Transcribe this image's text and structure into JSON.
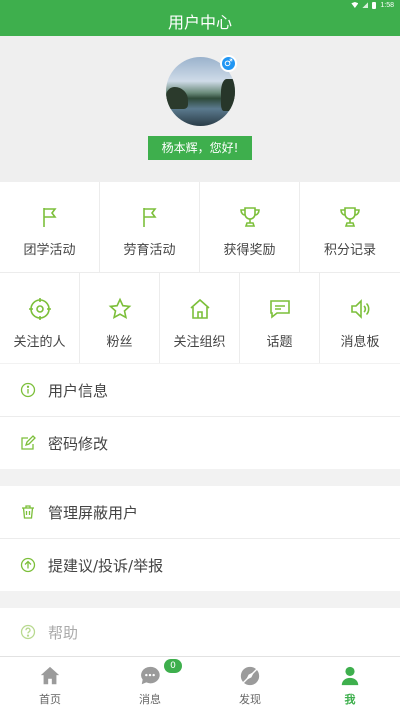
{
  "status_bar": {
    "time": "1:58"
  },
  "header": {
    "title": "用户中心"
  },
  "profile": {
    "greeting": "杨本辉，您好!",
    "gender_symbol": "♂"
  },
  "row1": [
    {
      "label": "团学活动",
      "icon": "flag-icon"
    },
    {
      "label": "劳育活动",
      "icon": "flag-icon"
    },
    {
      "label": "获得奖励",
      "icon": "trophy-icon"
    },
    {
      "label": "积分记录",
      "icon": "trophy-icon"
    }
  ],
  "row2": [
    {
      "label": "关注的人",
      "icon": "target-icon"
    },
    {
      "label": "粉丝",
      "icon": "star-icon"
    },
    {
      "label": "关注组织",
      "icon": "home-icon"
    },
    {
      "label": "话题",
      "icon": "chat-icon"
    },
    {
      "label": "消息板",
      "icon": "speaker-icon"
    }
  ],
  "list": [
    {
      "label": "用户信息",
      "icon": "info-icon"
    },
    {
      "label": "密码修改",
      "icon": "edit-icon"
    },
    {
      "label": "管理屏蔽用户",
      "icon": "trash-icon"
    },
    {
      "label": "提建议/投诉/举报",
      "icon": "upload-icon"
    },
    {
      "label": "帮助",
      "icon": "help-icon"
    }
  ],
  "tabs": [
    {
      "label": "首页",
      "icon": "home-icon"
    },
    {
      "label": "消息",
      "icon": "message-icon",
      "badge": "0"
    },
    {
      "label": "发现",
      "icon": "compass-icon"
    },
    {
      "label": "我",
      "icon": "user-icon"
    }
  ],
  "colors": {
    "brand": "#3eaf4d",
    "gender": "#2196f3",
    "icon": "#7cbf3a"
  }
}
